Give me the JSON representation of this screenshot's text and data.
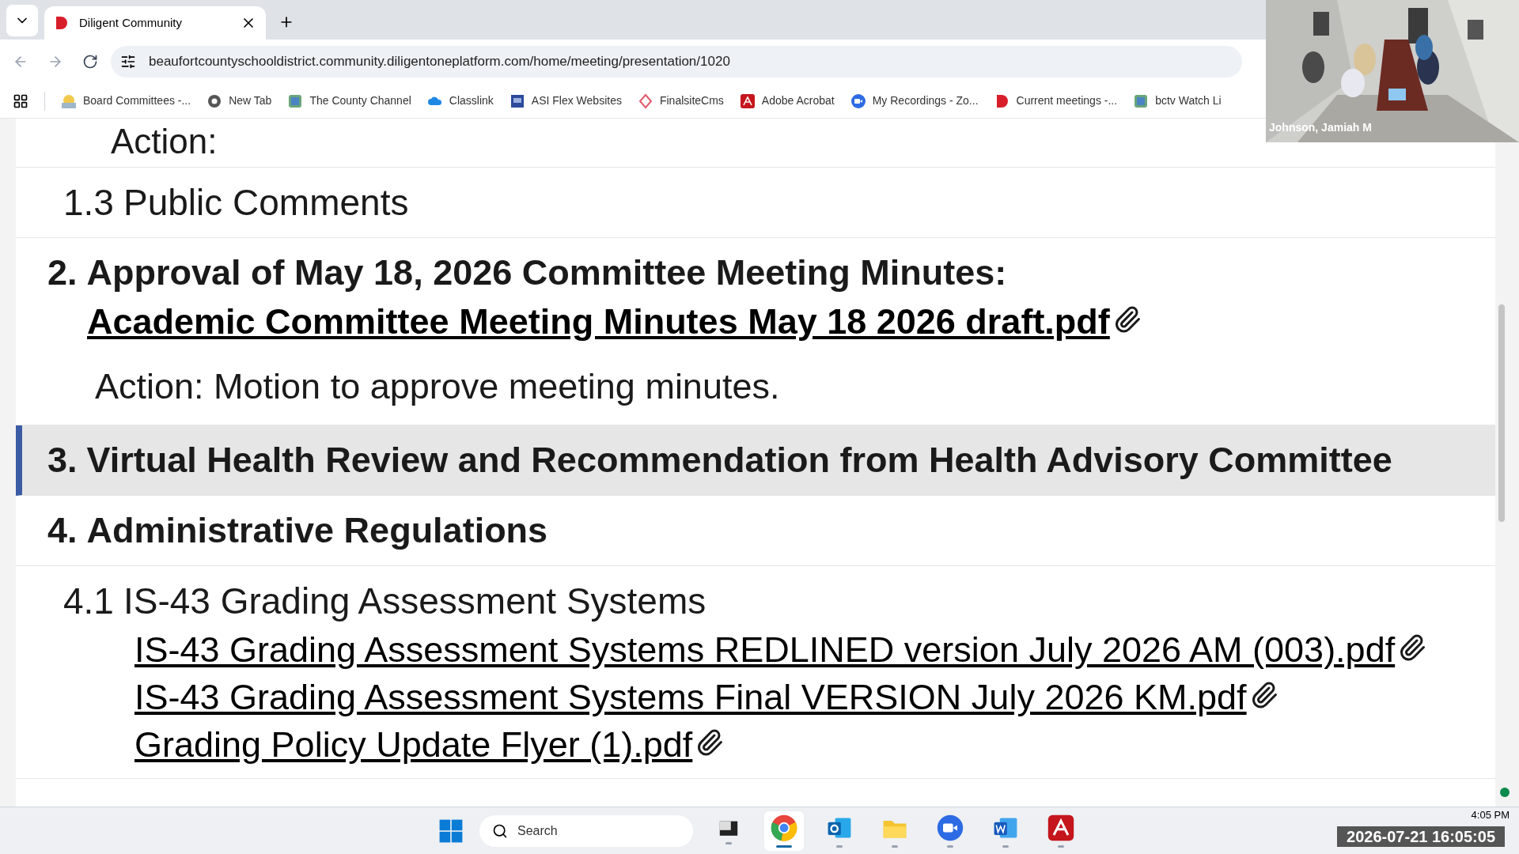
{
  "browser": {
    "tab": {
      "title": "Diligent Community"
    },
    "url": "beaufortcountyschooldistrict.community.diligentoneplatform.com/home/meeting/presentation/1020",
    "bookmarks": [
      {
        "label": "Board Committees -...",
        "kind": "sun"
      },
      {
        "label": "New Tab",
        "kind": "chrome"
      },
      {
        "label": "The County Channel",
        "kind": "tile"
      },
      {
        "label": "Classlink",
        "kind": "cloud"
      },
      {
        "label": "ASI Flex Websites",
        "kind": "asi"
      },
      {
        "label": "FinalsiteCms",
        "kind": "finalsite"
      },
      {
        "label": "Adobe Acrobat",
        "kind": "acrobat"
      },
      {
        "label": "My Recordings - Zo...",
        "kind": "zoom"
      },
      {
        "label": "Current meetings -...",
        "kind": "diligent"
      },
      {
        "label": "bctv Watch Li",
        "kind": "tile"
      }
    ]
  },
  "agenda": [
    {
      "kind": "cut",
      "text": "Action:"
    },
    {
      "kind": "sub",
      "number": "1.3",
      "title": "Public Comments",
      "selected": false
    },
    {
      "kind": "main",
      "number": "2.",
      "title": "Approval of May 18, 2026 Committee Meeting Minutes:",
      "selected": false,
      "links": [
        "Academic Committee Meeting Minutes May 18 2026 draft.pdf"
      ],
      "action": "Action: Motion to approve meeting minutes."
    },
    {
      "kind": "main",
      "number": "3.",
      "title": "Virtual Health Review and Recommendation from Health Advisory Committee",
      "selected": true
    },
    {
      "kind": "main",
      "number": "4.",
      "title": "Administrative Regulations",
      "selected": false
    },
    {
      "kind": "sub",
      "number": "4.1",
      "title": "IS-43 Grading Assessment Systems",
      "selected": false,
      "links": [
        "IS-43 Grading Assessment Systems REDLINED version July 2026 AM (003).pdf",
        "IS-43 Grading Assessment Systems Final VERSION July 2026 KM.pdf",
        "Grading Policy Update Flyer (1).pdf"
      ]
    }
  ],
  "video": {
    "participant": "Johnson, Jamiah M",
    "kind": "picture"
  },
  "taskbar": {
    "search": {
      "placeholder": "Search"
    },
    "apps": [
      {
        "kind": "explorer-dark",
        "selected": false
      },
      {
        "kind": "chrome",
        "selected": true
      },
      {
        "kind": "outlook",
        "selected": false
      },
      {
        "kind": "folder",
        "selected": false
      },
      {
        "kind": "zoom",
        "selected": false
      },
      {
        "kind": "word",
        "selected": false
      },
      {
        "kind": "acrobat",
        "selected": false
      }
    ],
    "clock": "4:05 PM",
    "overlay_timestamp": "2026-07-21  16:05:05"
  }
}
